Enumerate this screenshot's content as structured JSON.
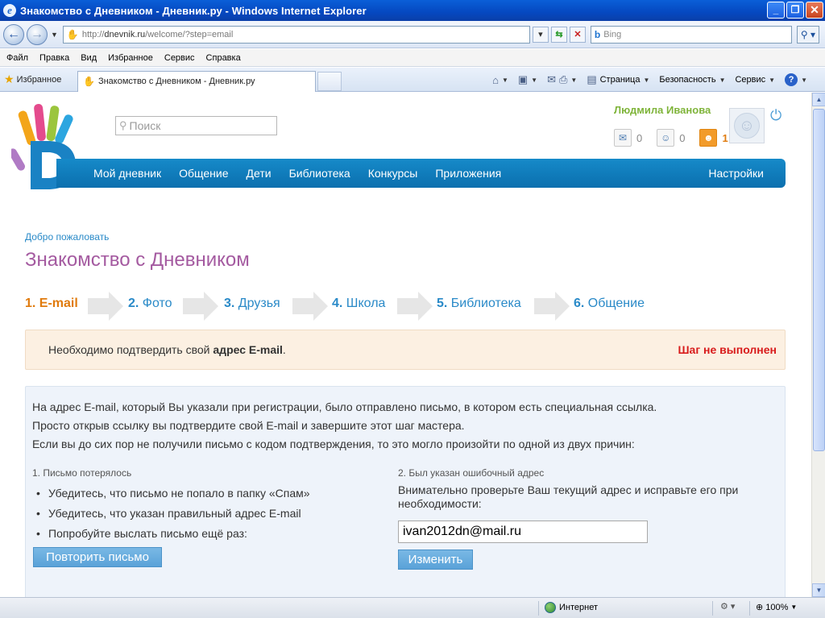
{
  "window": {
    "title": "Знакомство с Дневником - Дневник.ру - Windows Internet Explorer",
    "minimize": "_",
    "maximize": "❐",
    "close": "✕"
  },
  "address": {
    "url_proto": "http://",
    "url_host": "dnevnik.ru",
    "url_path": "/welcome/?step=email",
    "search_placeholder": "Bing"
  },
  "menu": [
    "Файл",
    "Правка",
    "Вид",
    "Избранное",
    "Сервис",
    "Справка"
  ],
  "favorites": {
    "label": "Избранное",
    "tab_title": "Знакомство с Дневником - Дневник.ру"
  },
  "command_bar": {
    "page": "Страница",
    "safety": "Безопасность",
    "tools": "Сервис"
  },
  "site": {
    "search_placeholder": "Поиск",
    "user_name": "Людмила Иванова",
    "counters": {
      "messages": "0",
      "friends": "0",
      "requests": "1"
    },
    "nav": [
      "Мой дневник",
      "Общение",
      "Дети",
      "Библиотека",
      "Конкурсы",
      "Приложения"
    ],
    "settings": "Настройки"
  },
  "page": {
    "breadcrumb": "Добро пожаловать",
    "title": "Знакомство с Дневником",
    "steps": [
      {
        "num": "1.",
        "label": "E-mail"
      },
      {
        "num": "2.",
        "label": "Фото"
      },
      {
        "num": "3.",
        "label": "Друзья"
      },
      {
        "num": "4.",
        "label": "Школа"
      },
      {
        "num": "5.",
        "label": "Библиотека"
      },
      {
        "num": "6.",
        "label": "Общение"
      }
    ],
    "alert": {
      "text_before": "Необходимо подтвердить свой ",
      "text_bold": "адрес E-mail",
      "text_after": ".",
      "status": "Шаг не выполнен"
    },
    "intro": [
      "На адрес E-mail, который Вы указали при регистрации, было отправлено письмо, в котором есть специальная ссылка.",
      "Просто открыв ссылку вы подтвердите свой E-mail и завершите этот шаг мастера.",
      "Если вы до сих пор не получили письмо с кодом подтверждения, то это могло произойти по одной из двух причин:"
    ],
    "left": {
      "title": "1. Письмо потерялось",
      "bullets": [
        "Убедитесь, что письмо не попало в папку «Спам»",
        "Убедитесь, что указан правильный адрес E-mail",
        "Попробуйте выслать письмо ещё раз:"
      ],
      "button": "Повторить письмо"
    },
    "right": {
      "title": "2. Был указан ошибочный адрес",
      "text": "Внимательно проверьте Ваш текущий адрес и исправьте его при необходимости:",
      "email_value": "ivan2012dn@mail.ru",
      "button": "Изменить"
    }
  },
  "status": {
    "zone": "Интернет",
    "zoom": "100%"
  },
  "colors": {
    "accent_blue": "#168ac9",
    "title_purple": "#a45aa0",
    "active_orange": "#e07b0e",
    "user_green": "#7fb43a",
    "error_red": "#d81b1b"
  }
}
